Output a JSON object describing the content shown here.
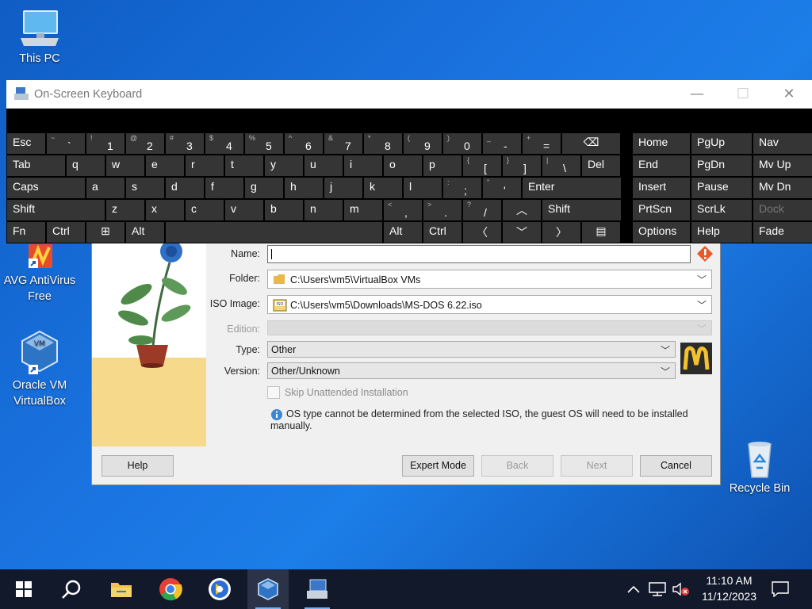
{
  "desktop": {
    "icons": [
      {
        "label": "This PC"
      },
      {
        "label": "AVG AntiVirus Free"
      },
      {
        "label": "Oracle VM VirtualBox"
      },
      {
        "label": "Recycle Bin"
      }
    ]
  },
  "osk": {
    "title": "On-Screen Keyboard",
    "controls": {
      "minimize": "—",
      "maximize": "☐",
      "close": "✕"
    },
    "rows": [
      [
        {
          "n": "Esc",
          "main": "Esc"
        },
        {
          "n": "tilde",
          "shift": "~",
          "main": "`"
        },
        {
          "n": "1",
          "shift": "!",
          "main": "1"
        },
        {
          "n": "2",
          "shift": "@",
          "main": "2"
        },
        {
          "n": "3",
          "shift": "#",
          "main": "3"
        },
        {
          "n": "4",
          "shift": "$",
          "main": "4"
        },
        {
          "n": "5",
          "shift": "%",
          "main": "5"
        },
        {
          "n": "6",
          "shift": "^",
          "main": "6"
        },
        {
          "n": "7",
          "shift": "&",
          "main": "7"
        },
        {
          "n": "8",
          "shift": "*",
          "main": "8"
        },
        {
          "n": "9",
          "shift": "(",
          "main": "9"
        },
        {
          "n": "0",
          "shift": ")",
          "main": "0"
        },
        {
          "n": "minus",
          "shift": "_",
          "main": "-"
        },
        {
          "n": "equals",
          "shift": "+",
          "main": "="
        },
        {
          "n": "backspace",
          "main": "⌫"
        }
      ],
      [
        {
          "n": "Tab",
          "main": "Tab"
        },
        {
          "n": "q",
          "main": "q"
        },
        {
          "n": "w",
          "main": "w"
        },
        {
          "n": "e",
          "main": "e"
        },
        {
          "n": "r",
          "main": "r"
        },
        {
          "n": "t",
          "main": "t"
        },
        {
          "n": "y",
          "main": "y"
        },
        {
          "n": "u",
          "main": "u"
        },
        {
          "n": "i",
          "main": "i"
        },
        {
          "n": "o",
          "main": "o"
        },
        {
          "n": "p",
          "main": "p"
        },
        {
          "n": "lbracket",
          "shift": "{",
          "main": "["
        },
        {
          "n": "rbracket",
          "shift": "}",
          "main": "]"
        },
        {
          "n": "backslash",
          "shift": "|",
          "main": "\\"
        },
        {
          "n": "Del",
          "main": "Del"
        }
      ],
      [
        {
          "n": "Caps",
          "main": "Caps"
        },
        {
          "n": "a",
          "main": "a"
        },
        {
          "n": "s",
          "main": "s"
        },
        {
          "n": "d",
          "main": "d"
        },
        {
          "n": "f",
          "main": "f"
        },
        {
          "n": "g",
          "main": "g"
        },
        {
          "n": "h",
          "main": "h"
        },
        {
          "n": "j",
          "main": "j"
        },
        {
          "n": "k",
          "main": "k"
        },
        {
          "n": "l",
          "main": "l"
        },
        {
          "n": "semicolon",
          "shift": ":",
          "main": ";"
        },
        {
          "n": "quote",
          "shift": "\"",
          "main": "'"
        },
        {
          "n": "Enter",
          "main": "Enter"
        }
      ],
      [
        {
          "n": "Shift-left",
          "main": "Shift"
        },
        {
          "n": "z",
          "main": "z"
        },
        {
          "n": "x",
          "main": "x"
        },
        {
          "n": "c",
          "main": "c"
        },
        {
          "n": "v",
          "main": "v"
        },
        {
          "n": "b",
          "main": "b"
        },
        {
          "n": "n",
          "main": "n"
        },
        {
          "n": "m",
          "main": "m"
        },
        {
          "n": "comma",
          "shift": "<",
          "main": ","
        },
        {
          "n": "period",
          "shift": ">",
          "main": "."
        },
        {
          "n": "slash",
          "shift": "?",
          "main": "/"
        },
        {
          "n": "up-arrow",
          "main": "︿"
        },
        {
          "n": "Shift-right",
          "main": "Shift"
        }
      ],
      [
        {
          "n": "Fn",
          "main": "Fn"
        },
        {
          "n": "Ctrl-left",
          "main": "Ctrl"
        },
        {
          "n": "windows",
          "main": "⊞"
        },
        {
          "n": "Alt-left",
          "main": "Alt"
        },
        {
          "n": "space",
          "main": ""
        },
        {
          "n": "Alt-right",
          "main": "Alt"
        },
        {
          "n": "Ctrl-right",
          "main": "Ctrl"
        },
        {
          "n": "left-arrow",
          "main": "〈"
        },
        {
          "n": "down-arrow",
          "main": "﹀"
        },
        {
          "n": "right-arrow",
          "main": "〉"
        },
        {
          "n": "menu",
          "main": "▤"
        }
      ]
    ],
    "nav": [
      [
        "Home",
        "PgUp",
        "Nav"
      ],
      [
        "End",
        "PgDn",
        "Mv Up"
      ],
      [
        "Insert",
        "Pause",
        "Mv Dn"
      ],
      [
        "PrtScn",
        "ScrLk",
        "Dock"
      ],
      [
        "Options",
        "Help",
        "Fade"
      ]
    ]
  },
  "wizard": {
    "name_label": "Name:",
    "name_value": "",
    "folder_label": "Folder:",
    "folder_value": "C:\\Users\\vm5\\VirtualBox VMs",
    "iso_label": "ISO Image:",
    "iso_value": "C:\\Users\\vm5\\Downloads\\MS-DOS 6.22.iso",
    "edition_label": "Edition:",
    "edition_value": "",
    "type_label": "Type:",
    "type_value": "Other",
    "version_label": "Version:",
    "version_value": "Other/Unknown",
    "skip_label": "Skip Unattended Installation",
    "info_text": "OS type cannot be determined from the selected ISO, the guest OS will need to be installed manually.",
    "buttons": {
      "help": "Help",
      "expert": "Expert Mode",
      "back": "Back",
      "next": "Next",
      "cancel": "Cancel"
    }
  },
  "taskbar": {
    "time": "11:10 AM",
    "date": "11/12/2023"
  },
  "colors": {
    "accent": "#1a73e0",
    "taskbar": "#11192b",
    "osk_key": "#353535"
  }
}
